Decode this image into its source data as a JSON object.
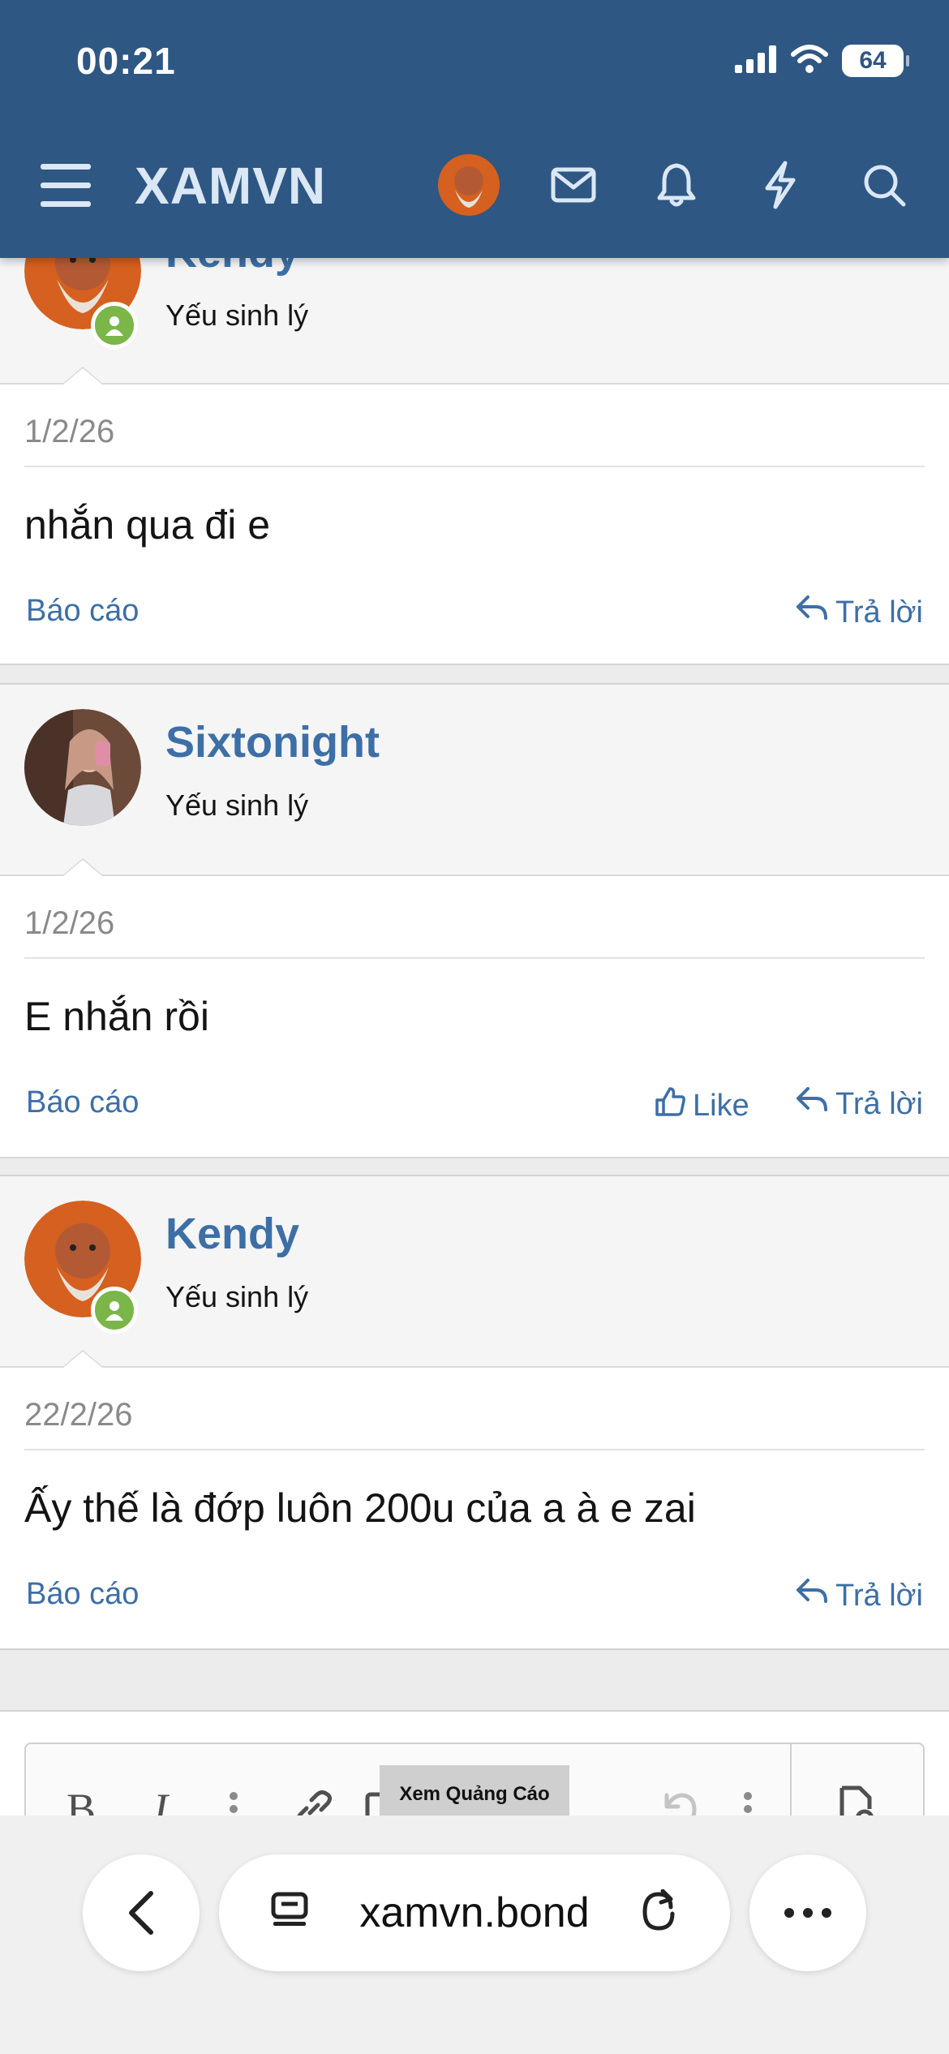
{
  "status_bar": {
    "time": "00:21",
    "battery": "64"
  },
  "header": {
    "brand": "XAMVN"
  },
  "posts": [
    {
      "username": "Kendy",
      "user_title": "Yếu sinh lý",
      "date": "1/2/26",
      "text": "nhắn qua đi e",
      "report_label": "Báo cáo",
      "reply_label": "Trả lời"
    },
    {
      "username": "Sixtonight",
      "user_title": "Yếu sinh lý",
      "date": "1/2/26",
      "text": "E nhắn rồi",
      "report_label": "Báo cáo",
      "like_label": "Like",
      "reply_label": "Trả lời"
    },
    {
      "username": "Kendy",
      "user_title": "Yếu sinh lý",
      "date": "22/2/26",
      "text": "Ấy thế là đớp luôn 200u của a à e zai",
      "report_label": "Báo cáo",
      "reply_label": "Trả lời"
    }
  ],
  "editor": {
    "bold": "B",
    "italic": "I",
    "ad_label": "Xem Quảng Cáo"
  },
  "browser": {
    "url": "xamvn.bond"
  },
  "colors": {
    "header": "#2e5783",
    "link": "#3d6fa6",
    "online": "#7ab648"
  }
}
